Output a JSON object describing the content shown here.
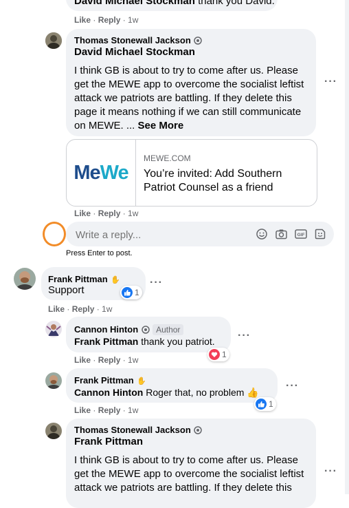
{
  "top_partial": {
    "name": "David Michael Stockman",
    "text": " thank you David.",
    "actions": {
      "like": "Like",
      "reply": "Reply",
      "time": "1w"
    }
  },
  "comment1": {
    "author": "Thomas Stonewall Jackson",
    "mention": "David Michael Stockman",
    "text": "I think GB is about to try to come after us. Please get the MEWE app to overcome the socialist leftist attack we patriots are battling. If they delete this page it means nothing if we can still communicate on MEWE. ...",
    "see_more": "See More",
    "link_card": {
      "logo": "MeWe",
      "domain": "MEWE.COM",
      "title": "You’re invited: Add Southern Patriot Counsel as a friend"
    },
    "actions": {
      "like": "Like",
      "reply": "Reply",
      "time": "1w"
    }
  },
  "reply_box": {
    "placeholder": "Write a reply...",
    "hint": "Press Enter to post."
  },
  "comment2": {
    "author": "Frank Pittman",
    "text": "Support",
    "reaction_count": "1",
    "actions": {
      "like": "Like",
      "reply": "Reply",
      "time": "1w"
    }
  },
  "reply1": {
    "author": "Cannon Hinton",
    "author_badge": "Author",
    "mention": "Frank Pittman",
    "text": " thank you patriot.",
    "reaction_count": "1",
    "actions": {
      "like": "Like",
      "reply": "Reply",
      "time": "1w"
    }
  },
  "reply2": {
    "author": "Frank Pittman",
    "mention": "Cannon Hinton",
    "text": " Roger that, no problem",
    "emoji": "👍",
    "reaction_count": "1",
    "actions": {
      "like": "Like",
      "reply": "Reply",
      "time": "1w"
    }
  },
  "reply3": {
    "author": "Thomas Stonewall Jackson",
    "mention": "Frank Pittman",
    "text": "I think GB is about to try to come after us. Please get the MEWE app to overcome the socialist leftist attack we patriots are battling. If they delete this"
  },
  "colors": {
    "bubble": "#f0f2f5",
    "meta_text": "#65676b",
    "like_blue": "#1877f2",
    "love_red": "#f33e58",
    "mewe_blue": "#1e4d8c",
    "mewe_teal": "#1ca9c9",
    "highlight_orange": "#f28c28"
  },
  "icons": [
    "verified-icon",
    "wave-icon",
    "like-reaction-icon",
    "love-reaction-icon",
    "emoji-icon",
    "camera-icon",
    "gif-icon",
    "sticker-icon",
    "more-icon"
  ]
}
